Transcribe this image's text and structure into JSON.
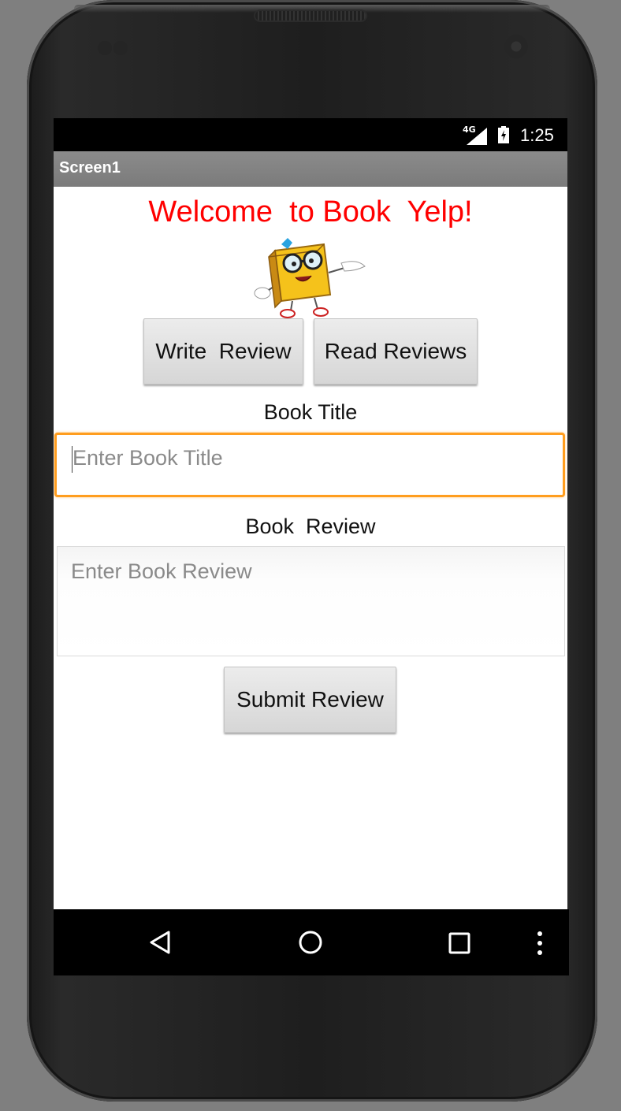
{
  "status_bar": {
    "network": "4G",
    "time": "1:25"
  },
  "app": {
    "title": "Screen1",
    "welcome": "Welcome  to Book  Yelp!",
    "buttons": {
      "write_review": "Write  Review",
      "read_reviews": "Read Reviews",
      "submit_review": "Submit Review"
    },
    "book_title_label": "Book Title",
    "book_title_placeholder": "Enter Book Title",
    "book_review_label": "Book  Review",
    "book_review_placeholder": "Enter Book Review"
  },
  "nav_bar": {
    "icons": [
      "back-icon",
      "home-icon",
      "recents-icon",
      "overflow-menu-icon"
    ]
  },
  "colors": {
    "welcome_text": "#ff0000",
    "focus_border": "#ff9d1e",
    "title_bar": "#808080"
  }
}
